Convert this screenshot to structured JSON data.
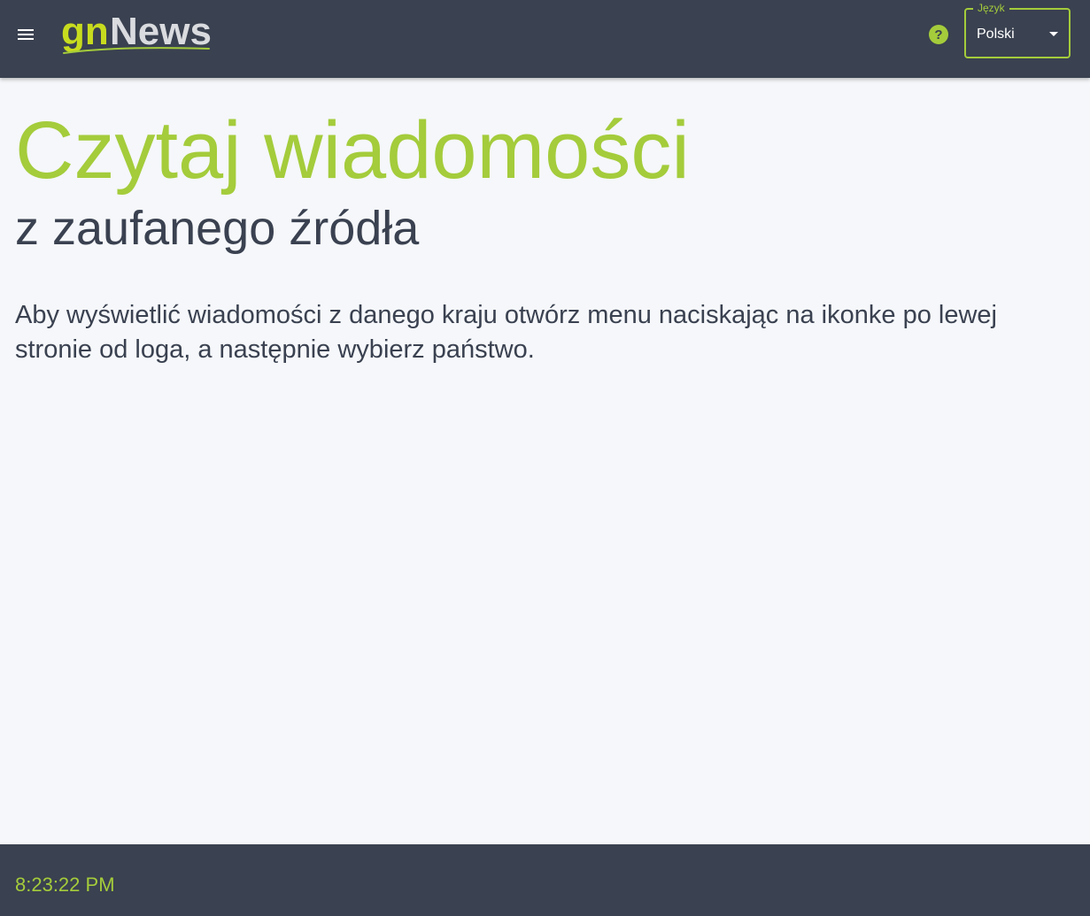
{
  "header": {
    "menu_icon": "menu-icon",
    "logo": {
      "part1": "gn",
      "part2": "News",
      "colors": {
        "part1": "#c8dc1e",
        "part2": "#d9dbdf",
        "swoosh": "#a4cc3b"
      }
    },
    "help_icon": "help-icon",
    "help_glyph": "?",
    "language": {
      "label": "Język",
      "selected": "Polski"
    }
  },
  "main": {
    "headline": "Czytaj wiadomości",
    "subheadline": "z zaufanego źródła",
    "instructions": "Aby wyświetlić wiadomości z danego kraju otwórz menu naciskając na ikonke po lewej stronie od loga, a następnie wybierz państwo."
  },
  "footer": {
    "clock": "8:23:22 PM"
  },
  "colors": {
    "header_bg": "#3a4150",
    "page_bg": "#f5f7fa",
    "accent": "#a4cc3b",
    "text_dark": "#3a4150"
  }
}
